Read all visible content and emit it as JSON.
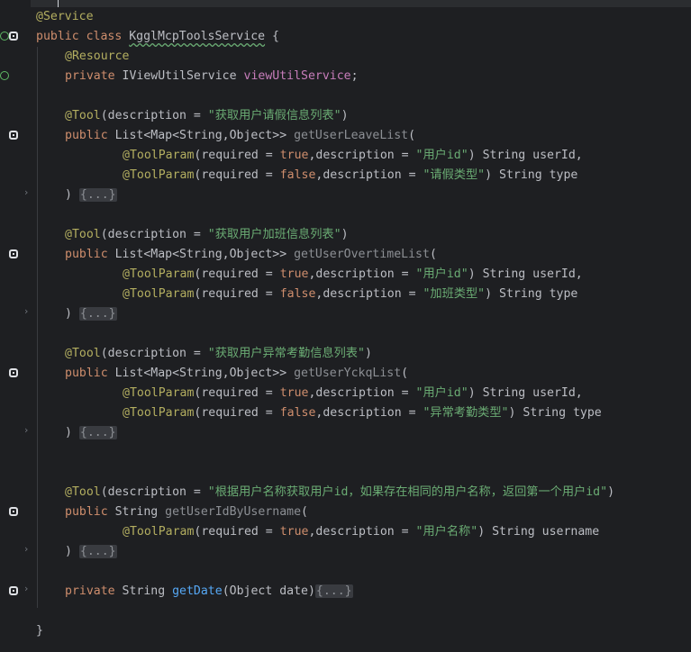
{
  "editor": {
    "lines": [
      {
        "id": "l1",
        "tokens": [
          {
            "t": "@Service",
            "c": "ann"
          }
        ]
      },
      {
        "id": "l2",
        "tokens": [
          {
            "t": "public class ",
            "c": "kw"
          },
          {
            "t": "KgglMcpToolsService",
            "c": "cls squig"
          },
          {
            "t": " {",
            "c": "cls"
          }
        ]
      },
      {
        "id": "l3",
        "indent": 1,
        "tokens": [
          {
            "t": "@Resource",
            "c": "ann"
          }
        ]
      },
      {
        "id": "l4",
        "indent": 1,
        "tokens": [
          {
            "t": "private ",
            "c": "kw"
          },
          {
            "t": "IViewUtilService ",
            "c": "cls"
          },
          {
            "t": "viewUtilService",
            "c": "fld"
          },
          {
            "t": ";",
            "c": "cls"
          }
        ]
      },
      {
        "id": "l5",
        "tokens": []
      },
      {
        "id": "l6",
        "indent": 1,
        "tokens": [
          {
            "t": "@Tool",
            "c": "ann"
          },
          {
            "t": "(description = ",
            "c": "cls"
          },
          {
            "t": "\"获取用户请假信息列表\"",
            "c": "str"
          },
          {
            "t": ")",
            "c": "cls"
          }
        ]
      },
      {
        "id": "l7",
        "indent": 1,
        "tokens": [
          {
            "t": "public ",
            "c": "kw"
          },
          {
            "t": "List<Map<String,Object>> ",
            "c": "cls"
          },
          {
            "t": "getUserLeaveList",
            "c": "fnd"
          },
          {
            "t": "(",
            "c": "cls"
          }
        ]
      },
      {
        "id": "l8",
        "indent": 3,
        "tokens": [
          {
            "t": "@ToolParam",
            "c": "ann"
          },
          {
            "t": "(required = ",
            "c": "cls"
          },
          {
            "t": "true",
            "c": "kw"
          },
          {
            "t": ",description = ",
            "c": "cls"
          },
          {
            "t": "\"用户id\"",
            "c": "str"
          },
          {
            "t": ") String userId,",
            "c": "cls"
          }
        ]
      },
      {
        "id": "l9",
        "indent": 3,
        "tokens": [
          {
            "t": "@ToolParam",
            "c": "ann"
          },
          {
            "t": "(required = ",
            "c": "cls"
          },
          {
            "t": "false",
            "c": "kw"
          },
          {
            "t": ",description = ",
            "c": "cls"
          },
          {
            "t": "\"请假类型\"",
            "c": "str"
          },
          {
            "t": ") String type",
            "c": "cls"
          }
        ]
      },
      {
        "id": "l10",
        "indent": 1,
        "tokens": [
          {
            "t": ") ",
            "c": "cls"
          },
          {
            "t": "{...}",
            "c": "fold"
          }
        ]
      },
      {
        "id": "l11",
        "tokens": []
      },
      {
        "id": "l12",
        "indent": 1,
        "tokens": [
          {
            "t": "@Tool",
            "c": "ann"
          },
          {
            "t": "(description = ",
            "c": "cls"
          },
          {
            "t": "\"获取用户加班信息列表\"",
            "c": "str"
          },
          {
            "t": ")",
            "c": "cls"
          }
        ]
      },
      {
        "id": "l13",
        "indent": 1,
        "tokens": [
          {
            "t": "public ",
            "c": "kw"
          },
          {
            "t": "List<Map<String,Object>> ",
            "c": "cls"
          },
          {
            "t": "getUserOvertimeList",
            "c": "fnd"
          },
          {
            "t": "(",
            "c": "cls"
          }
        ]
      },
      {
        "id": "l14",
        "indent": 3,
        "tokens": [
          {
            "t": "@ToolParam",
            "c": "ann"
          },
          {
            "t": "(required = ",
            "c": "cls"
          },
          {
            "t": "true",
            "c": "kw"
          },
          {
            "t": ",description = ",
            "c": "cls"
          },
          {
            "t": "\"用户id\"",
            "c": "str"
          },
          {
            "t": ") String userId,",
            "c": "cls"
          }
        ]
      },
      {
        "id": "l15",
        "indent": 3,
        "tokens": [
          {
            "t": "@ToolParam",
            "c": "ann"
          },
          {
            "t": "(required = ",
            "c": "cls"
          },
          {
            "t": "false",
            "c": "kw"
          },
          {
            "t": ",description = ",
            "c": "cls"
          },
          {
            "t": "\"加班类型\"",
            "c": "str"
          },
          {
            "t": ") String type",
            "c": "cls"
          }
        ]
      },
      {
        "id": "l16",
        "indent": 1,
        "tokens": [
          {
            "t": ") ",
            "c": "cls"
          },
          {
            "t": "{...}",
            "c": "fold"
          }
        ]
      },
      {
        "id": "l17",
        "tokens": []
      },
      {
        "id": "l18",
        "indent": 1,
        "tokens": [
          {
            "t": "@Tool",
            "c": "ann"
          },
          {
            "t": "(description = ",
            "c": "cls"
          },
          {
            "t": "\"获取用户异常考勤信息列表\"",
            "c": "str"
          },
          {
            "t": ")",
            "c": "cls"
          }
        ]
      },
      {
        "id": "l19",
        "indent": 1,
        "tokens": [
          {
            "t": "public ",
            "c": "kw"
          },
          {
            "t": "List<Map<String,Object>> ",
            "c": "cls"
          },
          {
            "t": "getUserYckqList",
            "c": "fnd"
          },
          {
            "t": "(",
            "c": "cls"
          }
        ]
      },
      {
        "id": "l20",
        "indent": 3,
        "tokens": [
          {
            "t": "@ToolParam",
            "c": "ann"
          },
          {
            "t": "(required = ",
            "c": "cls"
          },
          {
            "t": "true",
            "c": "kw"
          },
          {
            "t": ",description = ",
            "c": "cls"
          },
          {
            "t": "\"用户id\"",
            "c": "str"
          },
          {
            "t": ") String userId,",
            "c": "cls"
          }
        ]
      },
      {
        "id": "l21",
        "indent": 3,
        "tokens": [
          {
            "t": "@ToolParam",
            "c": "ann"
          },
          {
            "t": "(required = ",
            "c": "cls"
          },
          {
            "t": "false",
            "c": "kw"
          },
          {
            "t": ",description = ",
            "c": "cls"
          },
          {
            "t": "\"异常考勤类型\"",
            "c": "str"
          },
          {
            "t": ") String type",
            "c": "cls"
          }
        ]
      },
      {
        "id": "l22",
        "indent": 1,
        "tokens": [
          {
            "t": ") ",
            "c": "cls"
          },
          {
            "t": "{...}",
            "c": "fold"
          }
        ]
      },
      {
        "id": "l23",
        "tokens": []
      },
      {
        "id": "l24",
        "tokens": []
      },
      {
        "id": "l25",
        "indent": 1,
        "tokens": [
          {
            "t": "@Tool",
            "c": "ann"
          },
          {
            "t": "(description = ",
            "c": "cls"
          },
          {
            "t": "\"根据用户名称获取用户id，如果存在相同的用户名称，返回第一个用户id\"",
            "c": "str"
          },
          {
            "t": ")",
            "c": "cls"
          }
        ]
      },
      {
        "id": "l26",
        "indent": 1,
        "tokens": [
          {
            "t": "public ",
            "c": "kw"
          },
          {
            "t": "String ",
            "c": "cls"
          },
          {
            "t": "getUserIdByUsername",
            "c": "fnd"
          },
          {
            "t": "(",
            "c": "cls"
          }
        ]
      },
      {
        "id": "l27",
        "indent": 3,
        "tokens": [
          {
            "t": "@ToolParam",
            "c": "ann"
          },
          {
            "t": "(required = ",
            "c": "cls"
          },
          {
            "t": "true",
            "c": "kw"
          },
          {
            "t": ",description = ",
            "c": "cls"
          },
          {
            "t": "\"用户名称\"",
            "c": "str"
          },
          {
            "t": ") String username",
            "c": "cls"
          }
        ]
      },
      {
        "id": "l28",
        "indent": 1,
        "tokens": [
          {
            "t": ") ",
            "c": "cls"
          },
          {
            "t": "{...}",
            "c": "fold"
          }
        ]
      },
      {
        "id": "l29",
        "tokens": []
      },
      {
        "id": "l30",
        "indent": 1,
        "tokens": [
          {
            "t": "private ",
            "c": "kw"
          },
          {
            "t": "String ",
            "c": "cls"
          },
          {
            "t": "getDate",
            "c": "fn"
          },
          {
            "t": "(Object date)",
            "c": "cls"
          },
          {
            "t": "{...}",
            "c": "fold"
          }
        ]
      },
      {
        "id": "l31",
        "tokens": []
      },
      {
        "id": "l32",
        "tokens": [
          {
            "t": "}",
            "c": "cls"
          }
        ]
      }
    ]
  },
  "gutter": {
    "run_icon": "run-gutter-icon",
    "implement_icon": "implement-gutter-icon",
    "fold_icon": "fold-chevron-icon",
    "chevron_glyph": "›"
  },
  "colors": {
    "background": "#1e1f22",
    "annotation": "#b3ae60",
    "keyword": "#cf8e6d",
    "string": "#6aab73",
    "method_call": "#56a8f5",
    "field": "#c77dba",
    "text": "#bcbec4"
  }
}
